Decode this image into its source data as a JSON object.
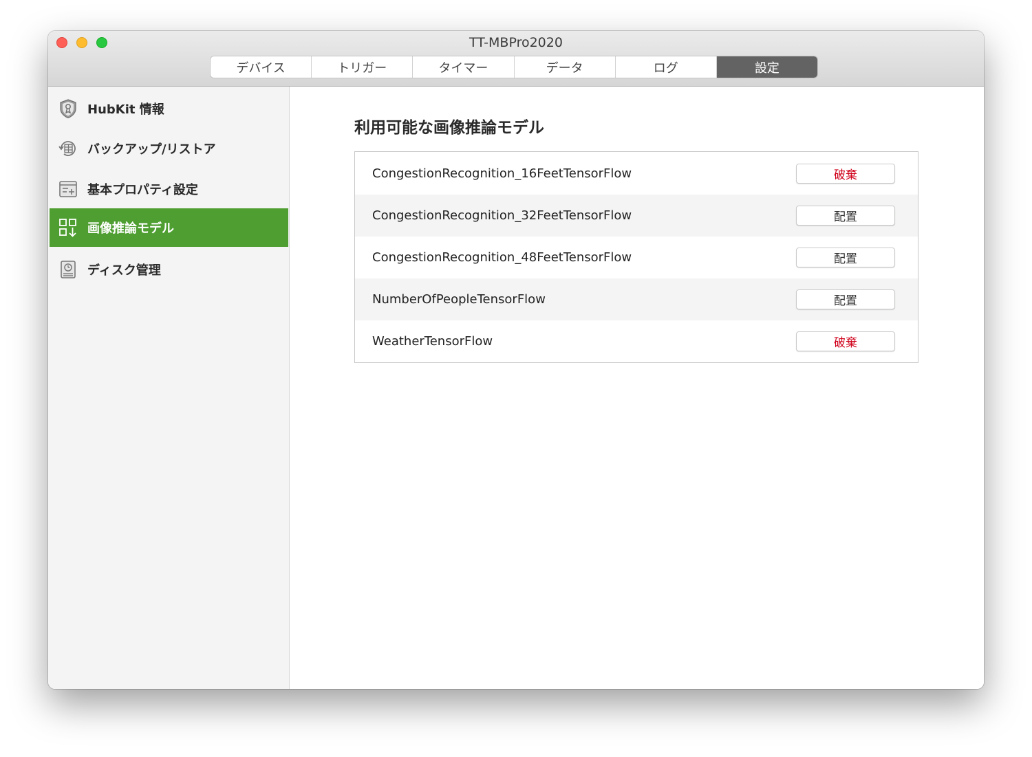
{
  "window": {
    "title": "TT-MBPro2020"
  },
  "tabs": [
    {
      "label": "デバイス",
      "active": false
    },
    {
      "label": "トリガー",
      "active": false
    },
    {
      "label": "タイマー",
      "active": false
    },
    {
      "label": "データ",
      "active": false
    },
    {
      "label": "ログ",
      "active": false
    },
    {
      "label": "設定",
      "active": true
    }
  ],
  "sidebar": {
    "items": [
      {
        "label": "HubKit 情報",
        "icon": "shield-badge-icon",
        "active": false
      },
      {
        "label": "バックアップ/リストア",
        "icon": "backup-restore-icon",
        "active": false
      },
      {
        "label": "基本プロパティ設定",
        "icon": "properties-icon",
        "active": false
      },
      {
        "label": "画像推論モデル",
        "icon": "model-grid-icon",
        "active": true
      },
      {
        "label": "ディスク管理",
        "icon": "disk-icon",
        "active": false
      }
    ]
  },
  "main": {
    "title": "利用可能な画像推論モデル",
    "models": [
      {
        "name": "CongestionRecognition_16FeetTensorFlow",
        "action": "破棄",
        "action_type": "discard"
      },
      {
        "name": "CongestionRecognition_32FeetTensorFlow",
        "action": "配置",
        "action_type": "deploy"
      },
      {
        "name": "CongestionRecognition_48FeetTensorFlow",
        "action": "配置",
        "action_type": "deploy"
      },
      {
        "name": "NumberOfPeopleTensorFlow",
        "action": "配置",
        "action_type": "deploy"
      },
      {
        "name": "WeatherTensorFlow",
        "action": "破棄",
        "action_type": "discard"
      }
    ]
  },
  "colors": {
    "accent_green": "#4e9e31",
    "active_tab": "#636363",
    "discard_red": "#d0021b"
  }
}
